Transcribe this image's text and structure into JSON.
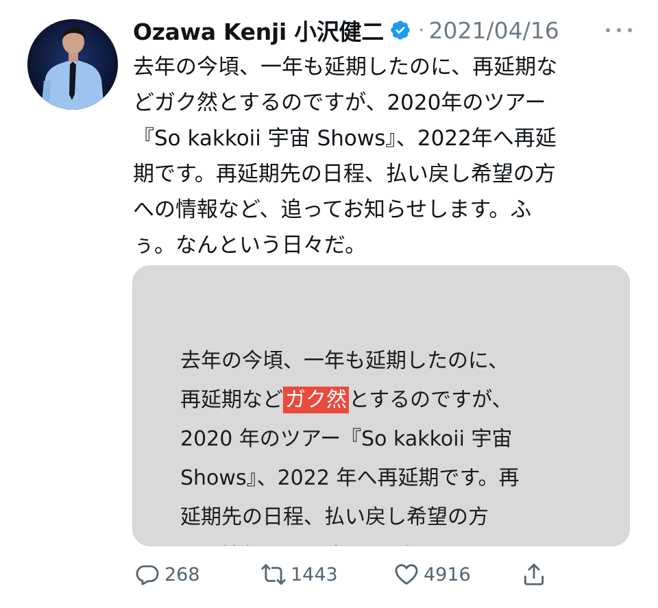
{
  "author": {
    "name": "Ozawa Kenji 小沢健二",
    "verified": true,
    "separator": "·",
    "date": "2021/04/16"
  },
  "tweet_lines": [
    "去年の今頃、一年も延期したのに、再延期な",
    "どガク然とするのですが、2020年のツアー",
    "『So kakkoii 宇宙 Shows』、2022年へ再延",
    "期です。再延期先の日程、払い戻し希望の方",
    "への情報など、追ってお知らせします。ふ",
    "ぅ。なんという日々だ。"
  ],
  "media": {
    "line1": "去年の今頃、一年も延期したのに、",
    "line2_before": "再延期など",
    "line2_highlight": "ガク然",
    "line2_after": "とするのですが、",
    "line3": "2020 年のツアー『So kakkoii 宇宙",
    "line4": "Shows』、2022 年へ再延期です。再",
    "line5": "延期先の日程、払い戻し希望の方",
    "line6": "への情報など、追ってお知らせしま",
    "highlight_color": "#e94a3c"
  },
  "actions": {
    "replies": "268",
    "retweets": "1443",
    "likes": "4916"
  },
  "colors": {
    "verified": "#1d9bf0",
    "secondary_text": "#536471",
    "media_bg": "#d9d9d9"
  },
  "icons": [
    "avatar-photo",
    "verified-badge-icon",
    "more-icon",
    "reply-icon",
    "retweet-icon",
    "like-icon",
    "share-icon"
  ]
}
